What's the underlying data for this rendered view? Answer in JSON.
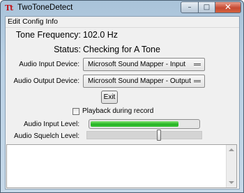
{
  "window": {
    "title": "TwoToneDetect"
  },
  "menu": {
    "items": [
      "Edit",
      "Config",
      "Info"
    ]
  },
  "tone": {
    "label": "Tone Frequency:",
    "value": "102.0 Hz"
  },
  "status": {
    "label": "Status:",
    "value": "Checking for A Tone"
  },
  "audio_input": {
    "label": "Audio Input Device:",
    "selected": "Microsoft Sound Mapper - Input"
  },
  "audio_output": {
    "label": "Audio Output Device:",
    "selected": "Microsoft Sound Mapper - Output"
  },
  "exit_button": "Exit",
  "playback": {
    "label": "Playback during record",
    "checked": false
  },
  "input_level": {
    "label": "Audio Input Level:",
    "fraction": 0.82,
    "color": "#25b324"
  },
  "squelch": {
    "label": "Audio Squelch Level:",
    "fraction": 0.63
  },
  "log": {
    "text": ""
  }
}
